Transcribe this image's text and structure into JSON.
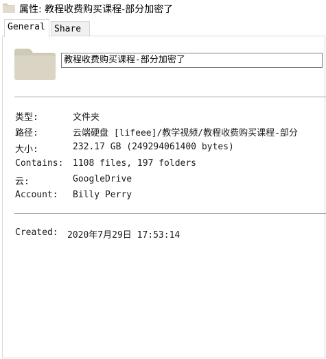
{
  "window": {
    "title": "属性: 教程收费购买课程-部分加密了",
    "icon": "folder-icon"
  },
  "tabs": [
    {
      "label": "General",
      "active": true
    },
    {
      "label": "Share",
      "active": false
    }
  ],
  "general": {
    "folder_name": "教程收费购买课程-部分加密了",
    "fields": [
      {
        "label": "类型:",
        "value": "文件夹"
      },
      {
        "label": "路径:",
        "value": "云端硬盘 [lifeee]/教学视频/教程收费购买课程-部分"
      },
      {
        "label": "大小:",
        "value": "232.17 GB (249294061400 bytes)"
      },
      {
        "label": "Contains:",
        "value": "1108 files, 197 folders"
      },
      {
        "label": "云:",
        "value": "GoogleDrive"
      },
      {
        "label": "Account:",
        "value": "Billy Perry"
      }
    ],
    "created": {
      "label": "Created:",
      "value": "2020年7月29日 17:53:14"
    }
  },
  "colors": {
    "folder": "#d9d4c4",
    "folder_tab": "#cfc9b7",
    "separator": "#a0a0a0",
    "border": "#d9d9d9"
  }
}
